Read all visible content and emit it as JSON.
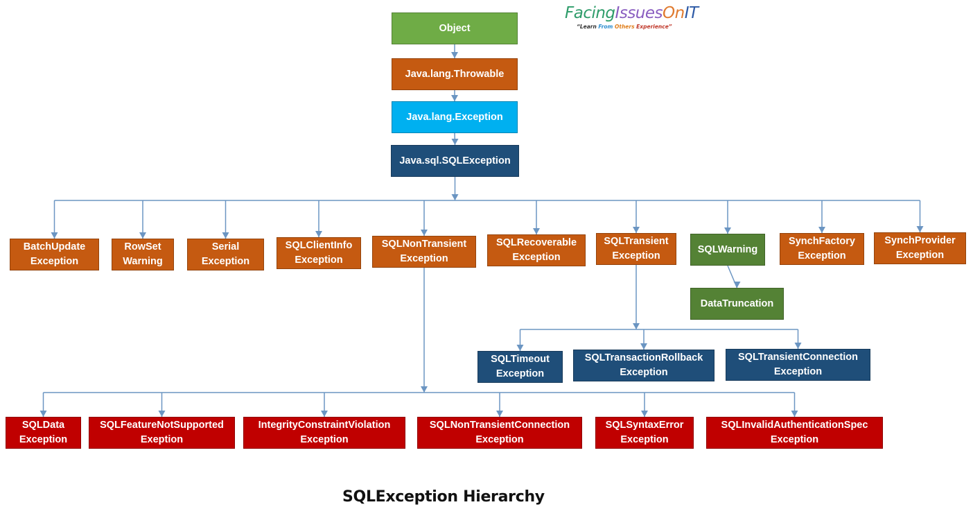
{
  "logo": {
    "title_parts": [
      "Facing",
      "Issues",
      "On",
      "IT"
    ],
    "tagline_parts": [
      "“Learn ",
      "From ",
      "Others ",
      "Experience”"
    ]
  },
  "caption": "SQLExceptionHierarchy",
  "caption_text": "SQLException Hierarchy",
  "colors": {
    "object": "#6fac46",
    "throwable": "#c55a11",
    "exception": "#00b0f0",
    "sqlexception": "#1f4e79",
    "sql_subclass": "#c55a11",
    "warning": "#548235",
    "transient_subclass": "#1f4e79",
    "nontransient_subclass": "#c00000",
    "connector": "#6b95c2"
  },
  "nodes": {
    "object": {
      "lines": [
        "Object"
      ]
    },
    "throwable": {
      "lines": [
        "Java.lang.Throwable"
      ]
    },
    "exception": {
      "lines": [
        "Java.lang.Exception"
      ]
    },
    "sqlexception": {
      "lines": [
        "Java.sql.SQLException"
      ]
    },
    "batchupdate": {
      "lines": [
        "BatchUpdate",
        "Exception"
      ]
    },
    "rowset": {
      "lines": [
        "RowSet",
        "Warning"
      ]
    },
    "serial": {
      "lines": [
        "Serial",
        "Exception"
      ]
    },
    "clientinfo": {
      "lines": [
        "SQLClientInfo",
        "Exception"
      ]
    },
    "nontransient": {
      "lines": [
        "SQLNonTransient",
        "Exception"
      ]
    },
    "recoverable": {
      "lines": [
        "SQLRecoverable",
        "Exception"
      ]
    },
    "transient": {
      "lines": [
        "SQLTransient",
        "Exception"
      ]
    },
    "warning": {
      "lines": [
        "SQLWarning"
      ]
    },
    "synchfactory": {
      "lines": [
        "SynchFactory",
        "Exception"
      ]
    },
    "synchprovider": {
      "lines": [
        "SynchProvider",
        "Exception"
      ]
    },
    "datatruncation": {
      "lines": [
        "DataTruncation"
      ]
    },
    "timeout": {
      "lines": [
        "SQLTimeout",
        "Exception"
      ]
    },
    "rollback": {
      "lines": [
        "SQLTransactionRollback",
        "Exception"
      ]
    },
    "transientconn": {
      "lines": [
        "SQLTransientConnection",
        "Exception"
      ]
    },
    "data": {
      "lines": [
        "SQLData",
        "Exception"
      ]
    },
    "featurenotsupported": {
      "lines": [
        "SQLFeatureNotSupported",
        "Exeption"
      ]
    },
    "integrity": {
      "lines": [
        "IntegrityConstraintViolation",
        "Exception"
      ]
    },
    "nontransientconn": {
      "lines": [
        "SQLNonTransientConnection",
        "Exception"
      ]
    },
    "syntax": {
      "lines": [
        "SQLSyntaxError",
        "Exception"
      ]
    },
    "invalidauth": {
      "lines": [
        "SQLInvalidAuthenticationSpec",
        "Exception"
      ]
    }
  },
  "edges": [
    [
      "object",
      "throwable"
    ],
    [
      "throwable",
      "exception"
    ],
    [
      "exception",
      "sqlexception"
    ],
    [
      "sqlexception",
      "batchupdate"
    ],
    [
      "sqlexception",
      "rowset"
    ],
    [
      "sqlexception",
      "serial"
    ],
    [
      "sqlexception",
      "clientinfo"
    ],
    [
      "sqlexception",
      "nontransient"
    ],
    [
      "sqlexception",
      "recoverable"
    ],
    [
      "sqlexception",
      "transient"
    ],
    [
      "sqlexception",
      "warning"
    ],
    [
      "sqlexception",
      "synchfactory"
    ],
    [
      "sqlexception",
      "synchprovider"
    ],
    [
      "warning",
      "datatruncation"
    ],
    [
      "transient",
      "timeout"
    ],
    [
      "transient",
      "rollback"
    ],
    [
      "transient",
      "transientconn"
    ],
    [
      "nontransient",
      "data"
    ],
    [
      "nontransient",
      "featurenotsupported"
    ],
    [
      "nontransient",
      "integrity"
    ],
    [
      "nontransient",
      "nontransientconn"
    ],
    [
      "nontransient",
      "syntax"
    ],
    [
      "nontransient",
      "invalidauth"
    ]
  ]
}
